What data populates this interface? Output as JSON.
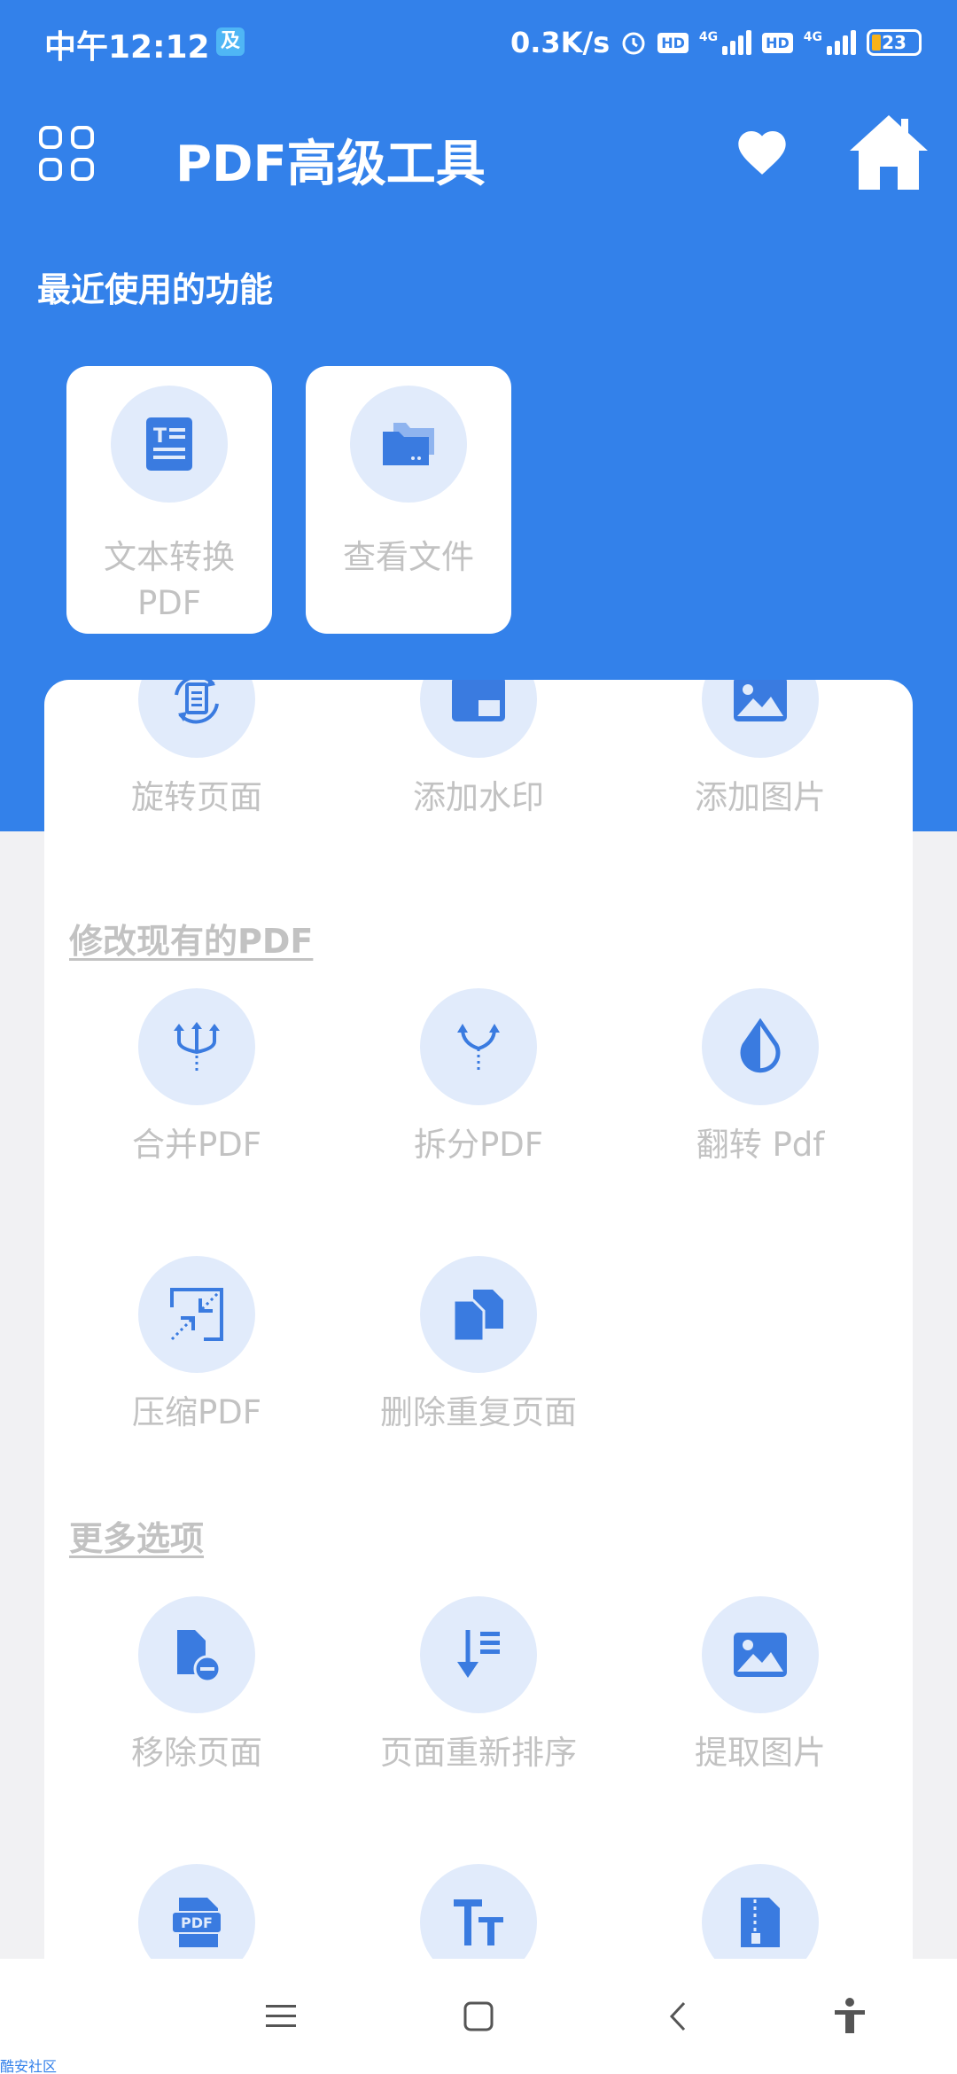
{
  "status_bar": {
    "time": "中午12:12",
    "app_badge": "及",
    "speed": "0.3K/s",
    "hd_badge": "HD",
    "net1": "4G",
    "net2": "4G",
    "battery": "23"
  },
  "header": {
    "title": "PDF高级工具"
  },
  "recent": {
    "title": "最近使用的功能",
    "items": [
      {
        "label": "文本转换PDF",
        "icon": "text-document-icon"
      },
      {
        "label": "查看文件",
        "icon": "folders-icon"
      }
    ]
  },
  "top_row": [
    {
      "label": "旋转页面",
      "icon": "rotate-page-icon"
    },
    {
      "label": "添加水印",
      "icon": "watermark-icon"
    },
    {
      "label": "添加图片",
      "icon": "image-icon"
    }
  ],
  "modify_section": {
    "title": "修改现有的PDF",
    "items": [
      {
        "label": "合并PDF",
        "icon": "merge-icon"
      },
      {
        "label": "拆分PDF",
        "icon": "split-icon"
      },
      {
        "label": "翻转 Pdf",
        "icon": "invert-drop-icon"
      },
      {
        "label": "压缩PDF",
        "icon": "compress-icon"
      },
      {
        "label": "删除重复页面",
        "icon": "duplicate-pages-icon"
      }
    ]
  },
  "more_section": {
    "title": "更多选项",
    "items": [
      {
        "label": "移除页面",
        "icon": "remove-page-icon"
      },
      {
        "label": "页面重新排序",
        "icon": "reorder-icon"
      },
      {
        "label": "提取图片",
        "icon": "extract-image-icon"
      },
      {
        "label": "PDF",
        "icon": "pdf-file-icon"
      },
      {
        "label": "",
        "icon": "text-size-icon"
      },
      {
        "label": "",
        "icon": "zip-file-icon"
      }
    ]
  },
  "watermark": "酷安社区",
  "colors": {
    "primary": "#3381ea",
    "icon_bg": "#e1ebfb",
    "muted_text": "#c2c2c2"
  }
}
